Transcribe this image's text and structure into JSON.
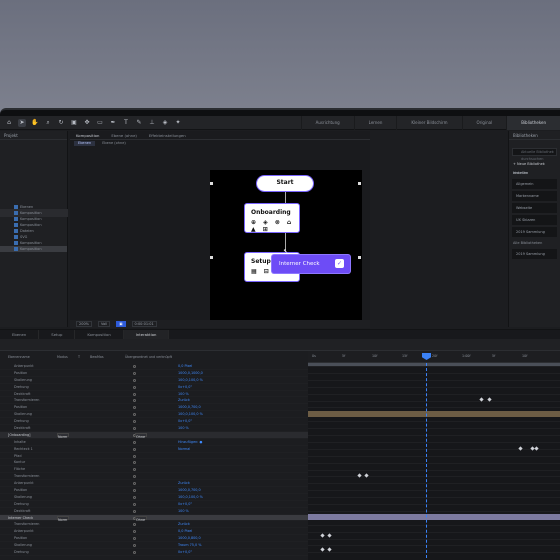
{
  "toolbar": {
    "workspaces": [
      "Ausrichtung",
      "Lernen",
      "Kleiner Bildschirm",
      "Original",
      "Bibliotheken"
    ],
    "active_workspace": 4
  },
  "project": {
    "title": "Projekt",
    "items": [
      "Ebenen",
      "Komposition",
      "Komposition",
      "Komposition",
      "Dateien",
      "SVG",
      "Komposition",
      "Komposition"
    ]
  },
  "viewer": {
    "tabs": [
      "Komposition",
      "Ebene (ohne)",
      "Effekteinstellungen"
    ],
    "subtabs": [
      "Ebenen",
      "Ebene (ohne)"
    ],
    "zoom": "200%",
    "quality": "Voll",
    "timecode": "0:00:01:01"
  },
  "mock": {
    "start": "Start",
    "onboarding": "Onboarding",
    "setup": "Setup",
    "check": "Interner Check",
    "onboarding_icons": "⊕ ◈ ⊗ ⌂ ▲ ⊞",
    "setup_icons": "▦ ⊟"
  },
  "libraries": {
    "title": "Bibliotheken",
    "search_placeholder": "Aktuelle Bibliothek durchsuchen",
    "new_library": "+ Neue Bibliothek erstellen",
    "section_recent": "Neueste",
    "items": [
      "Allgemein",
      "Markenname",
      "Webseite",
      "UX Skizzen",
      "2019 Sammlung"
    ],
    "section_libraries": "Alle Bibliotheken",
    "library_items": [
      "2019 Sammlung"
    ]
  },
  "timeline": {
    "tabs": [
      "Ebenen",
      "Setup",
      "Komposition",
      "Interaktion"
    ],
    "active_tab": 3,
    "columns": [
      "Ebenenname",
      "Modus",
      "T",
      "BewMas",
      "Übergeordnet und verknüpft"
    ],
    "ruler": [
      "0s",
      "5f",
      "10f",
      "15f",
      "20f",
      "1:00f",
      "5f",
      "10f"
    ],
    "rows": [
      {
        "name": "Ankerpunkt",
        "val": "0,0 Pixel",
        "type": "prop"
      },
      {
        "name": "Position",
        "val": "1000,0,1000,0",
        "type": "prop"
      },
      {
        "name": "Skalierung",
        "val": "100,0,100,0 %",
        "type": "prop"
      },
      {
        "name": "Drehung",
        "val": "0x+0,0°",
        "type": "prop"
      },
      {
        "name": "Deckkraft",
        "val": "100 %",
        "type": "prop"
      },
      {
        "name": "Transformieren",
        "val": "Zurück",
        "type": "prop"
      },
      {
        "name": "Position",
        "val": "1000,0,700,0",
        "type": "prop"
      },
      {
        "name": "Skalierung",
        "val": "100,0,100,0 %",
        "type": "prop"
      },
      {
        "name": "Drehung",
        "val": "0x+0,0°",
        "type": "prop"
      },
      {
        "name": "Deckkraft",
        "val": "100 %",
        "type": "prop"
      },
      {
        "name": "[Onboarding]",
        "val": "",
        "type": "layer",
        "mode": "Norm",
        "parent": "Ohne"
      },
      {
        "name": "Inhalte",
        "val": "Hinzufügen: ●",
        "type": "prop"
      },
      {
        "name": "Rechteck 1",
        "val": "Normal",
        "type": "prop"
      },
      {
        "name": "Pfad",
        "val": "",
        "type": "prop"
      },
      {
        "name": "Kontur",
        "val": "",
        "type": "prop"
      },
      {
        "name": "Fläche",
        "val": "",
        "type": "prop"
      },
      {
        "name": "Transformieren",
        "val": "",
        "type": "prop"
      },
      {
        "name": "Ankerpunkt",
        "val": "Zurück",
        "type": "prop"
      },
      {
        "name": "Position",
        "val": "1000,0,700,0",
        "type": "prop"
      },
      {
        "name": "Skalierung",
        "val": "100,0,100,0 %",
        "type": "prop"
      },
      {
        "name": "Drehung",
        "val": "0x+0,0°",
        "type": "prop"
      },
      {
        "name": "Deckkraft",
        "val": "100 %",
        "type": "prop"
      },
      {
        "name": "Interner Check",
        "val": "",
        "type": "layer sel",
        "mode": "Norm",
        "parent": "Ohne"
      },
      {
        "name": "Transformieren",
        "val": "Zurück",
        "type": "prop"
      },
      {
        "name": "Ankerpunkt",
        "val": "0,0 Pixel",
        "type": "prop"
      },
      {
        "name": "Position",
        "val": "1000,0,800,0",
        "type": "prop"
      },
      {
        "name": "Skalierung",
        "val": "Traum 75,0 %",
        "type": "prop"
      },
      {
        "name": "Drehung",
        "val": "0x+0,0°",
        "type": "prop"
      }
    ]
  }
}
